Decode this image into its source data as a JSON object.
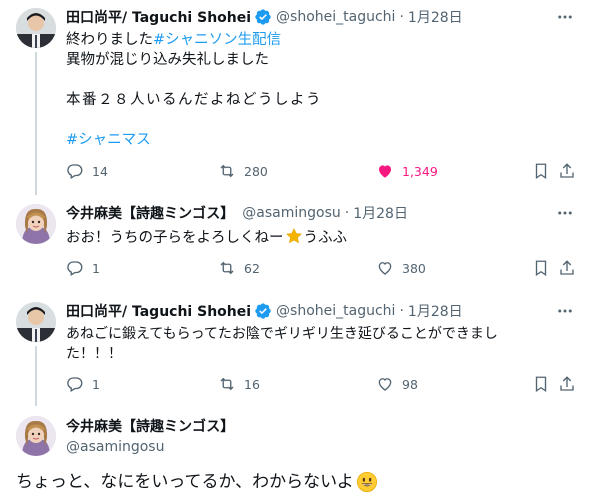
{
  "tweets": [
    {
      "name": "田口尚平/ Taguchi Shohei",
      "handle": "@shohei_taguchi",
      "date": "1月28日",
      "line1_prefix": "終わりました",
      "line1_hashtag": "#シャニソン生配信",
      "line2": "異物が混じり込み失礼しました",
      "line3": "本番２８人いるんだよねどうしよう",
      "line4_hashtag": "#シャニマス",
      "replies": "14",
      "reposts": "280",
      "likes": "1,349"
    },
    {
      "name": "今井麻美【詩趣ミンゴス】",
      "handle": "@asamingosu",
      "date": "1月28日",
      "text_before": "おお！うちの子らをよろしくねー",
      "text_after": "うふふ",
      "replies": "1",
      "reposts": "62",
      "likes": "380"
    },
    {
      "name": "田口尚平/ Taguchi Shohei",
      "handle": "@shohei_taguchi",
      "date": "1月28日",
      "line1": "あねごに鍛えてもらってたお陰でギリギリ生き延びることができまし",
      "line2": "た！！！",
      "replies": "1",
      "reposts": "16",
      "likes": "98"
    },
    {
      "name": "今井麻美【詩趣ミンゴス】",
      "handle": "@asamingosu",
      "text": "ちょっと、なにをいってるか、わからないよ"
    }
  ],
  "separator": "·",
  "colors": {
    "accent": "#1d9bf0",
    "like": "#f91880",
    "muted": "#536471",
    "thread_line": "#cfd9de"
  }
}
